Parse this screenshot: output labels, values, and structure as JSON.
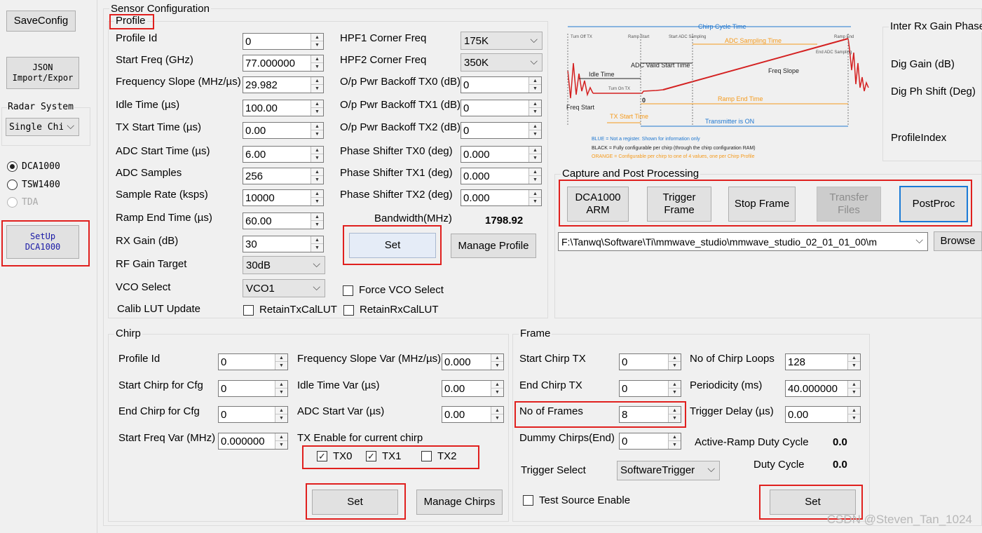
{
  "left_panel": {
    "save_config": "SaveConfig",
    "json_button": [
      "JSON",
      "Import/Expor"
    ],
    "radar_system_label": "Radar System",
    "radar_system_value": "Single Chi",
    "radios": [
      {
        "label": "DCA1000",
        "selected": true,
        "enabled": true
      },
      {
        "label": "TSW1400",
        "selected": false,
        "enabled": true
      },
      {
        "label": "TDA",
        "selected": false,
        "enabled": false
      }
    ],
    "setup_button": [
      "SetUp",
      "DCA1000"
    ]
  },
  "sensor_config": {
    "title": "Sensor Configuration",
    "profile": {
      "title": "Profile",
      "left_fields": [
        {
          "label": "Profile Id",
          "value": "0"
        },
        {
          "label": "Start Freq (GHz)",
          "value": "77.000000"
        },
        {
          "label": "Frequency Slope (MHz/µs)",
          "value": "29.982"
        },
        {
          "label": "Idle Time (µs)",
          "value": "100.00"
        },
        {
          "label": "TX Start Time (µs)",
          "value": "0.00"
        },
        {
          "label": "ADC Start Time (µs)",
          "value": "6.00"
        },
        {
          "label": "ADC Samples",
          "value": "256"
        },
        {
          "label": "Sample Rate (ksps)",
          "value": "10000"
        },
        {
          "label": "Ramp End Time (µs)",
          "value": "60.00"
        },
        {
          "label": "RX Gain (dB)",
          "value": "30"
        }
      ],
      "rf_gain_target": {
        "label": "RF Gain Target",
        "value": "30dB"
      },
      "vco_select": {
        "label": "VCO Select",
        "value": "VCO1"
      },
      "calib_lut": {
        "label": "Calib LUT Update",
        "retain_tx": "RetainTxCalLUT",
        "retain_rx": "RetainRxCalLUT"
      },
      "hpf1": {
        "label": "HPF1 Corner Freq",
        "value": "175K"
      },
      "hpf2": {
        "label": "HPF2 Corner Freq",
        "value": "350K"
      },
      "right_fields": [
        {
          "label": "O/p Pwr Backoff TX0 (dB)",
          "value": "0"
        },
        {
          "label": "O/p Pwr Backoff TX1 (dB)",
          "value": "0"
        },
        {
          "label": "O/p Pwr Backoff TX2 (dB)",
          "value": "0"
        },
        {
          "label": "Phase Shifter TX0 (deg)",
          "value": "0.000"
        },
        {
          "label": "Phase Shifter TX1 (deg)",
          "value": "0.000"
        },
        {
          "label": "Phase Shifter TX2 (deg)",
          "value": "0.000"
        }
      ],
      "bandwidth_label": "Bandwidth(MHz)",
      "bandwidth_value": "1798.92",
      "set_label": "Set",
      "manage_profile_label": "Manage Profile",
      "force_vco_label": "Force VCO Select"
    },
    "diagram": {
      "chirp_cycle_time": "Chirp Cycle Time",
      "turn_off_tx": "Turn Off TX",
      "ramp_start": "Ramp Start",
      "start_adc_sampling": "Start ADC Sampling",
      "ramp_end": "Ramp End",
      "adc_sampling_time": "ADC Sampling Time",
      "end_adc_sampling": "End ADC Sampling",
      "idle_time": "Idle Time",
      "adc_valid_start_time": "ADC Valid Start Time",
      "freq_slope": "Freq Slope",
      "turn_on_tx": "Turn On TX",
      "zero": "0",
      "ramp_end_time": "Ramp End Time",
      "freq_start": "Freq Start",
      "tx_start_time": "TX Start Time",
      "transmitter_on": "Transmitter is ON",
      "legend_blue": "BLUE = Not a register. Shown for information only",
      "legend_black": "BLACK = Fully configurable per chirp (through the chirp configuration RAM)",
      "legend_orange": "ORANGE = Configurable per chirp to one of 4 values, one per Chirp Profile",
      "colors": {
        "blue": "#1f77d0",
        "orange": "#f59a1b",
        "red": "#d42020",
        "black": "#222222"
      }
    },
    "inter_rx": {
      "title": "Inter Rx Gain Phase",
      "dig_gain": "Dig Gain (dB)",
      "dig_ph_shift": "Dig Ph Shift (Deg)",
      "profile_index": "ProfileIndex"
    }
  },
  "capture": {
    "title": "Capture and Post Processing",
    "dca_arm": [
      "DCA1000",
      "ARM"
    ],
    "trigger_frame": [
      "Trigger",
      "Frame"
    ],
    "stop_frame": "Stop Frame",
    "transfer_files": [
      "Transfer",
      "Files"
    ],
    "postproc": "PostProc",
    "path": "F:\\Tanwq\\Software\\Ti\\mmwave_studio\\mmwave_studio_02_01_01_00\\m",
    "browse": "Browse"
  },
  "chirp": {
    "title": "Chirp",
    "left_fields": [
      {
        "label": "Profile Id",
        "value": "0"
      },
      {
        "label": "Start Chirp for Cfg",
        "value": "0"
      },
      {
        "label": "End Chirp for Cfg",
        "value": "0"
      },
      {
        "label": "Start Freq Var (MHz)",
        "value": "0.000000"
      }
    ],
    "right_fields": [
      {
        "label": "Frequency Slope Var (MHz/µs)",
        "value": "0.000"
      },
      {
        "label": "Idle Time Var (µs)",
        "value": "0.00"
      },
      {
        "label": "ADC Start Var (µs)",
        "value": "0.00"
      }
    ],
    "tx_enable_label": "TX Enable for current chirp",
    "tx": [
      {
        "label": "TX0",
        "checked": true
      },
      {
        "label": "TX1",
        "checked": true
      },
      {
        "label": "TX2",
        "checked": false
      }
    ],
    "set_label": "Set",
    "manage_chirps_label": "Manage Chirps"
  },
  "frame": {
    "title": "Frame",
    "left_fields": [
      {
        "label": "Start Chirp TX",
        "value": "0"
      },
      {
        "label": "End Chirp TX",
        "value": "0"
      },
      {
        "label": "No of Frames",
        "value": "8"
      },
      {
        "label": "Dummy Chirps(End)",
        "value": "0"
      }
    ],
    "right_fields": [
      {
        "label": "No of Chirp Loops",
        "value": "128"
      },
      {
        "label": "Periodicity (ms)",
        "value": "40.000000"
      },
      {
        "label": "Trigger Delay (µs)",
        "value": "0.00"
      }
    ],
    "active_ramp_label": "Active-Ramp Duty Cycle",
    "active_ramp_value": "0.0",
    "duty_cycle_label": "Duty Cycle",
    "duty_cycle_value": "0.0",
    "trigger_select_label": "Trigger Select",
    "trigger_select_value": "SoftwareTrigger",
    "test_source_label": "Test Source Enable",
    "set_label": "Set"
  },
  "watermark": "CSDN @Steven_Tan_1024"
}
